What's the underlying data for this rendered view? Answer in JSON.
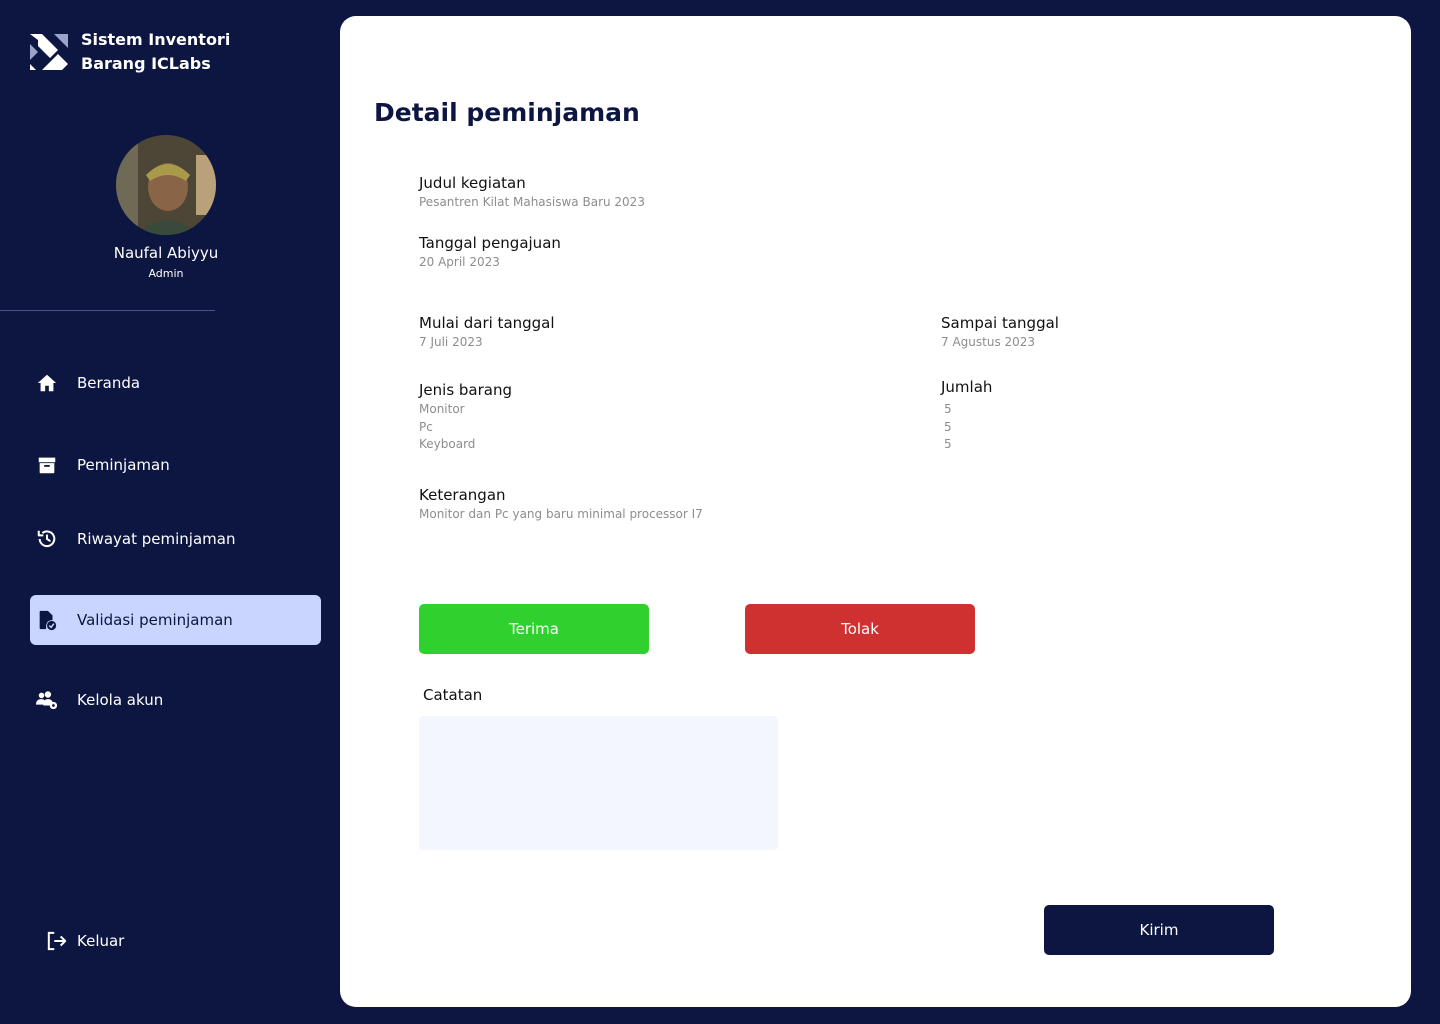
{
  "brand": {
    "title": "Sistem Inventori Barang ICLabs",
    "logo_icon": "iclabs-logo"
  },
  "user": {
    "name": "Naufal Abiyyu",
    "role": "Admin"
  },
  "nav": [
    {
      "label": "Beranda",
      "icon": "home-icon",
      "active": false
    },
    {
      "label": "Peminjaman",
      "icon": "box-icon",
      "active": false
    },
    {
      "label": "Riwayat peminjaman",
      "icon": "history-icon",
      "active": false
    },
    {
      "label": "Validasi peminjaman",
      "icon": "file-check-icon",
      "active": true
    },
    {
      "label": "Kelola akun",
      "icon": "users-gear-icon",
      "active": false
    }
  ],
  "logout_label": "Keluar",
  "page": {
    "title": "Detail peminjaman",
    "judul_label": "Judul kegiatan",
    "judul_value": "Pesantren Kilat Mahasiswa Baru 2023",
    "tanggal_pengajuan_label": "Tanggal pengajuan",
    "tanggal_pengajuan_value": "20 April 2023",
    "mulai_label": "Mulai dari tanggal",
    "mulai_value": "7 Juli 2023",
    "sampai_label": "Sampai tanggal",
    "sampai_value": "7 Agustus 2023",
    "jenis_label": "Jenis barang",
    "jumlah_label": "Jumlah",
    "items": [
      {
        "name": "Monitor",
        "qty": "5"
      },
      {
        "name": "Pc",
        "qty": "5"
      },
      {
        "name": "Keyboard",
        "qty": "5"
      }
    ],
    "keterangan_label": "Keterangan",
    "keterangan_value": "Monitor dan Pc yang baru minimal processor I7",
    "accept_label": "Terima",
    "reject_label": "Tolak",
    "note_label": "Catatan",
    "note_value": "",
    "send_label": "Kirim"
  },
  "colors": {
    "sidebar_bg": "#0d1640",
    "active_nav_bg": "#c9d4ff",
    "accept": "#30d12f",
    "reject": "#cf3131",
    "send": "#0d1640"
  }
}
